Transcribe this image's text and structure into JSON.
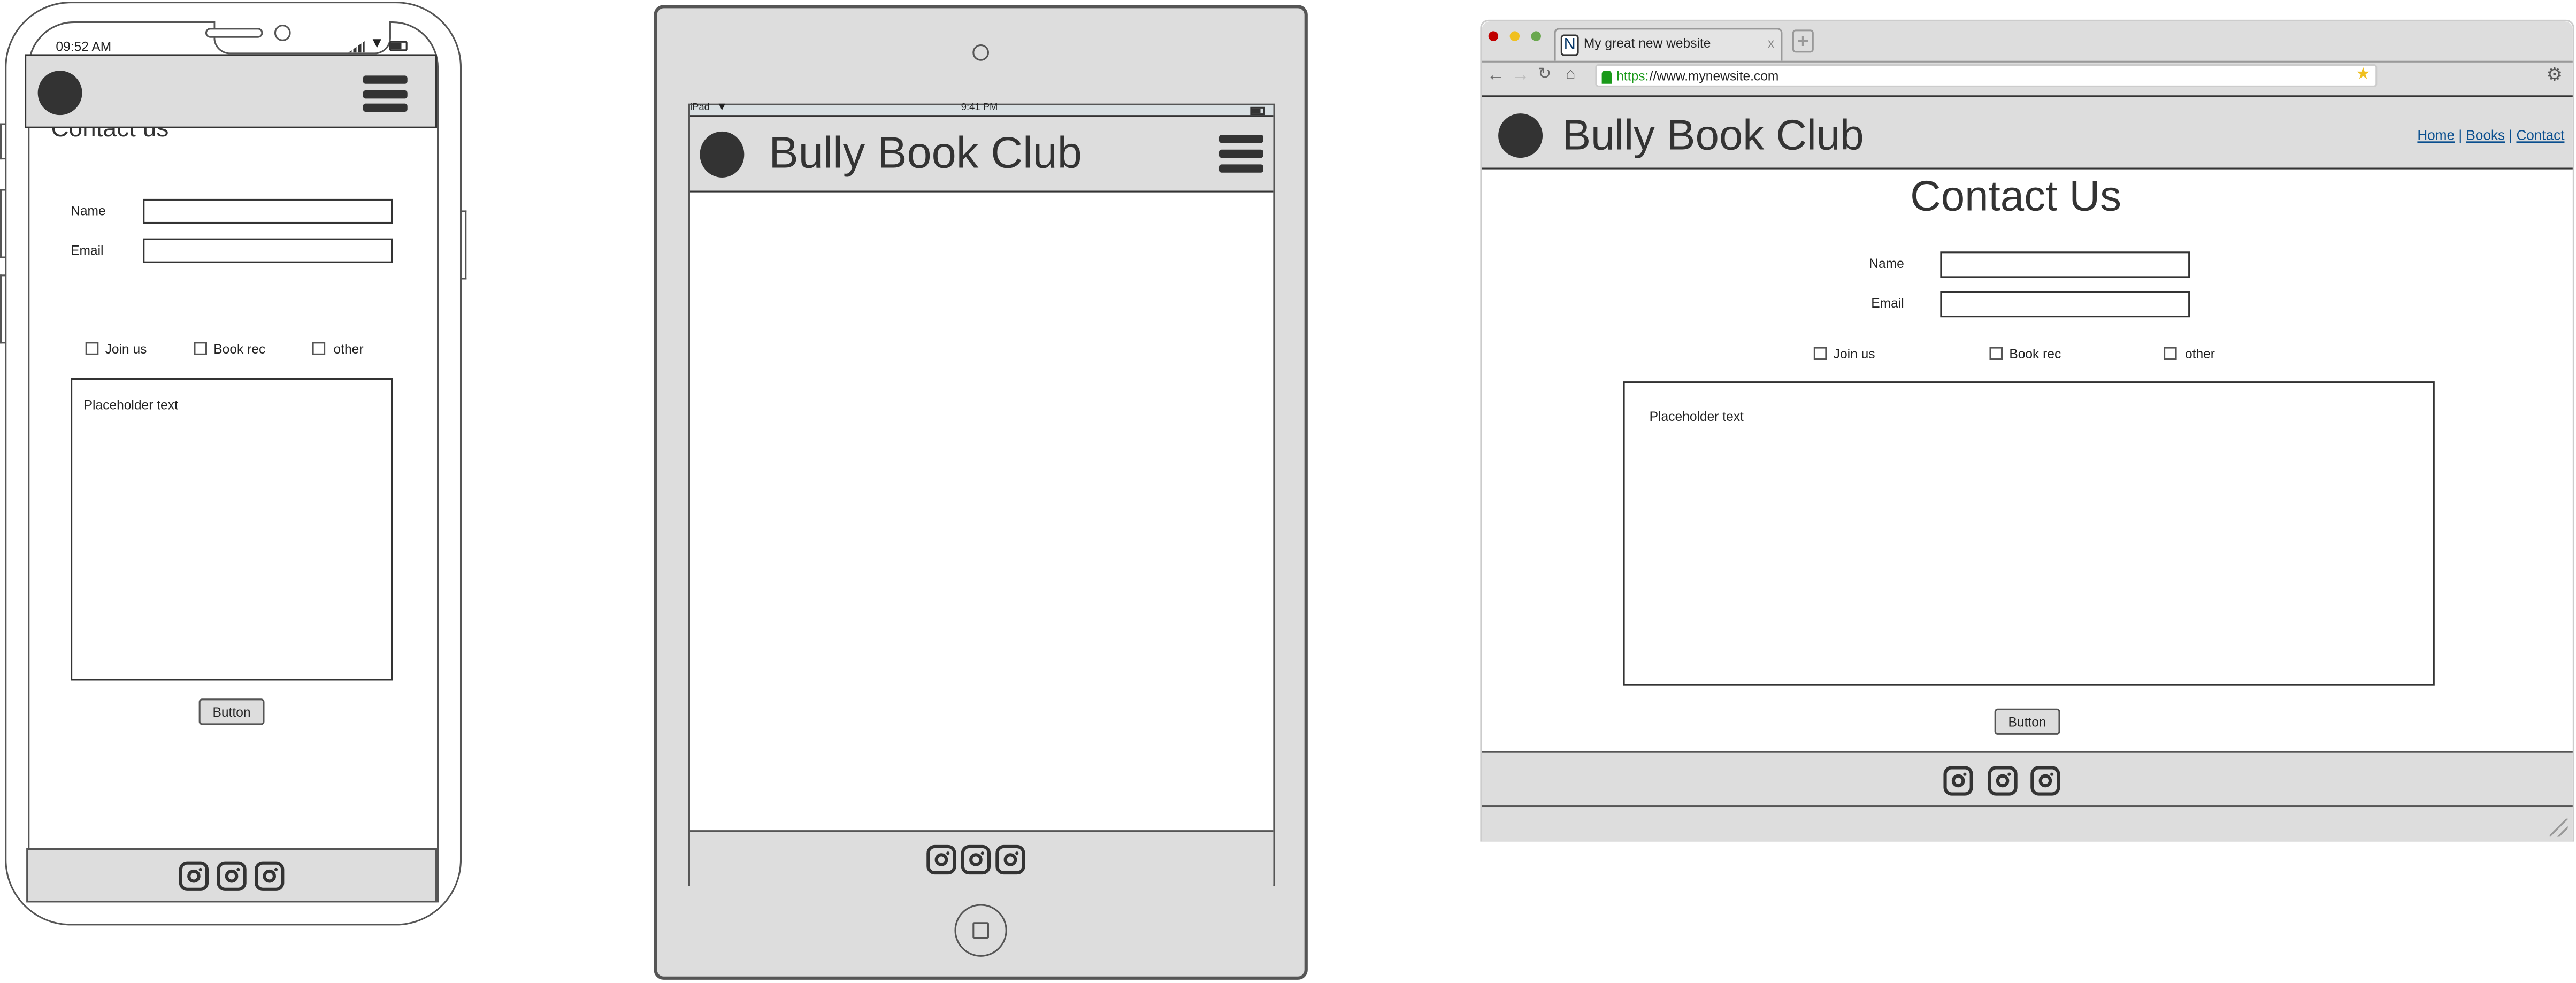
{
  "phone": {
    "status_time": "09:52 AM",
    "page_title": "Contact us",
    "form": {
      "name_label": "Name",
      "email_label": "Email",
      "name_value": "",
      "email_value": "",
      "checkboxes": [
        "Join us",
        "Book rec",
        "other"
      ],
      "textarea_placeholder": "Placeholder text",
      "button_label": "Button"
    },
    "footer_icons": [
      "instagram-icon",
      "instagram-icon",
      "instagram-icon"
    ]
  },
  "tablet": {
    "status_device": "iPad",
    "status_time": "9:41 PM",
    "site_title": "Bully Book Club",
    "footer_icons": [
      "instagram-icon",
      "instagram-icon",
      "instagram-icon"
    ]
  },
  "browser": {
    "tab_title": "My great new website",
    "tab_favicon": "N",
    "tab_close": "x",
    "url_scheme": "https:",
    "url_rest": "//www.mynewsite.com",
    "site_title": "Bully Book Club",
    "nav_links": [
      "Home",
      "Books",
      "Contact"
    ],
    "nav_separator": "|",
    "page_title": "Contact Us",
    "form": {
      "name_label": "Name",
      "email_label": "Email",
      "name_value": "",
      "email_value": "",
      "checkboxes": [
        "Join us",
        "Book rec",
        "other"
      ],
      "textarea_placeholder": "Placeholder text",
      "button_label": "Button"
    },
    "footer_icons": [
      "instagram-icon",
      "instagram-icon",
      "instagram-icon"
    ],
    "colors": {
      "link": "#0a4f8f",
      "secure": "#1a9a1a",
      "close": "#c00000",
      "minimize": "#f0c020",
      "maximize": "#6aa84f"
    }
  }
}
